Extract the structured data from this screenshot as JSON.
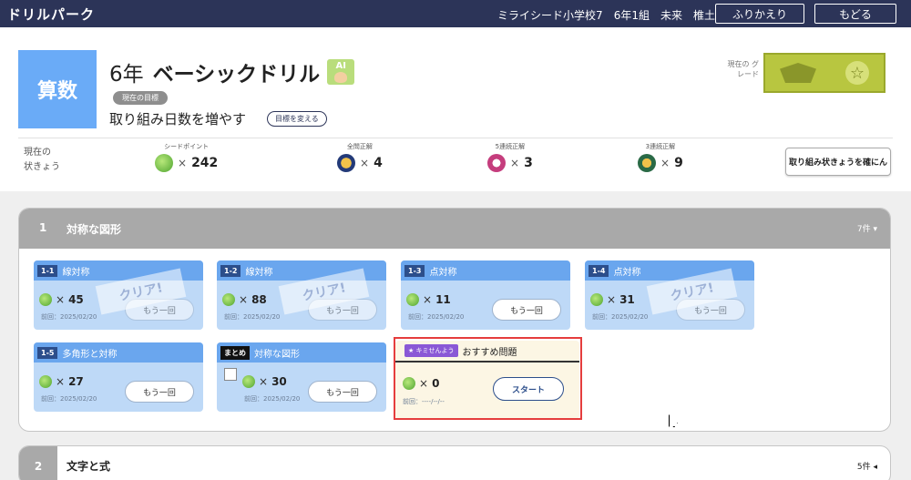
{
  "topbar": {
    "brand": "ドリルパーク",
    "school": "ミライシード小学校7",
    "class": "6年1組",
    "name1": "未来",
    "name2": "椎土",
    "review_btn": "ふりかえり",
    "back_btn": "もどる"
  },
  "drill": {
    "subject": "算数",
    "grade": "6年",
    "title": "ベーシックドリル",
    "ai_badge": "AI",
    "goal_pill": "現在の目標",
    "goal_text": "取り組み日数を増やす",
    "goal_change": "目標を変える",
    "current_grade_label": "現在の グレード"
  },
  "status": {
    "label_line1": "現在の",
    "label_line2": "状きょう",
    "seed_label": "シードポイント",
    "seed_value": "242",
    "allcorrect_label": "全問正解",
    "allcorrect_value": "4",
    "streak5_label": "5連続正解",
    "streak5_value": "3",
    "streak3_label": "3連続正解",
    "streak3_value": "9",
    "times": "×",
    "confirm_btn": "取り組み状きょうを確にん"
  },
  "section1": {
    "num": "1",
    "title": "対称な図形",
    "count": "7件 ▾",
    "cards": [
      {
        "id": "1-1",
        "title": "線対称",
        "count": "45",
        "date": "前回：2025/02/20",
        "btn": "もう一回",
        "stamp": "クリア!"
      },
      {
        "id": "1-2",
        "title": "線対称",
        "count": "88",
        "date": "前回：2025/02/20",
        "btn": "もう一回",
        "stamp": "クリア!"
      },
      {
        "id": "1-3",
        "title": "点対称",
        "count": "11",
        "date": "前回：2025/02/20",
        "btn": "もう一回",
        "stamp": ""
      },
      {
        "id": "1-4",
        "title": "点対称",
        "count": "31",
        "date": "前回：2025/02/20",
        "btn": "もう一回",
        "stamp": "クリア!"
      },
      {
        "id": "1-5",
        "title": "多角形と対称",
        "count": "27",
        "date": "前回：2025/02/20",
        "btn": "もう一回",
        "stamp": ""
      },
      {
        "id": "まとめ",
        "title": "対称な図形",
        "count": "30",
        "date": "前回：2025/02/20",
        "btn": "もう一回",
        "stamp": ""
      }
    ],
    "ai_card": {
      "badge": "キミせんよう",
      "title": "おすすめ問題",
      "count": "0",
      "date": "前回：----/--/--",
      "btn": "スタート"
    }
  },
  "section2": {
    "num": "2",
    "title": "文字と式",
    "count": "5件 ◂"
  },
  "colors": {
    "topbar": "#2c3458",
    "subject": "#6aabf7",
    "card": "#bed9f7",
    "card_head": "#6aa6ee",
    "highlight": "#e53d3d"
  }
}
